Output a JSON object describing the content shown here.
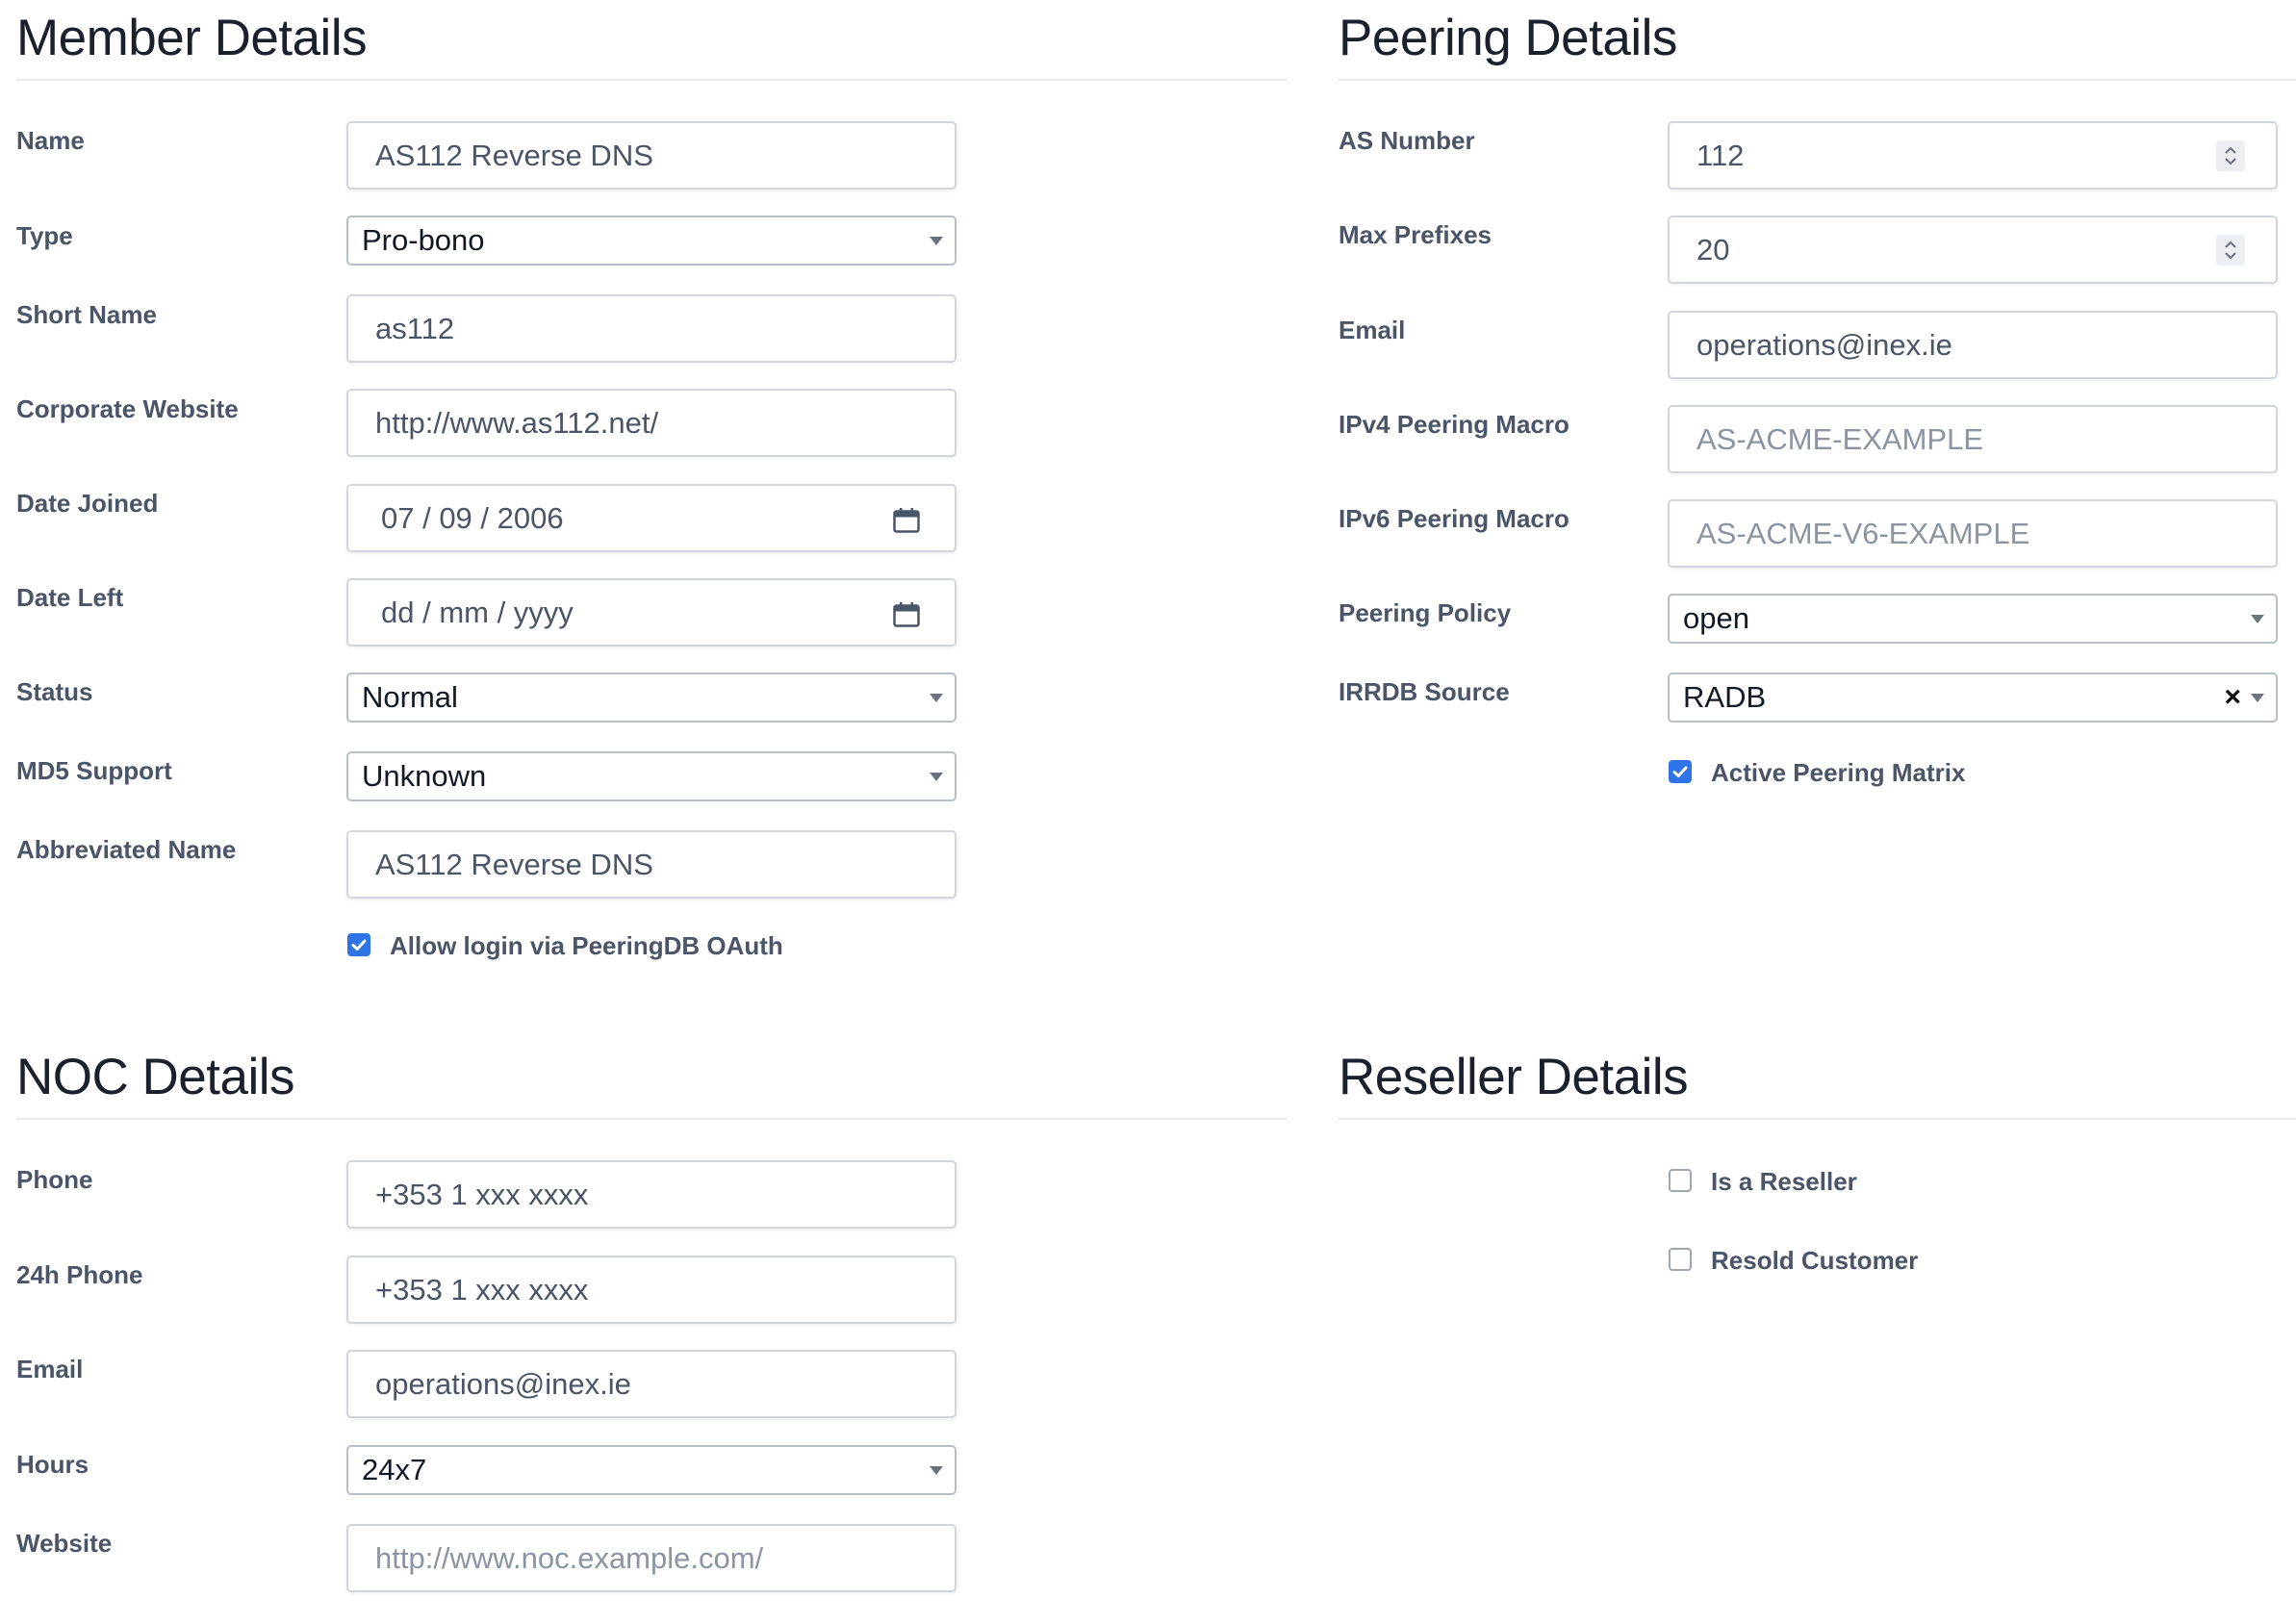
{
  "member": {
    "title": "Member Details",
    "fields": {
      "name": {
        "label": "Name",
        "value": "AS112 Reverse DNS"
      },
      "type": {
        "label": "Type",
        "value": "Pro-bono"
      },
      "short_name": {
        "label": "Short Name",
        "value": "as112"
      },
      "corporate_website": {
        "label": "Corporate Website",
        "value": "http://www.as112.net/"
      },
      "date_joined": {
        "label": "Date Joined",
        "value": "07 / 09 / 2006"
      },
      "date_left": {
        "label": "Date Left",
        "value": "dd / mm / yyyy"
      },
      "status": {
        "label": "Status",
        "value": "Normal"
      },
      "md5_support": {
        "label": "MD5 Support",
        "value": "Unknown"
      },
      "abbreviated_name": {
        "label": "Abbreviated Name",
        "value": "AS112 Reverse DNS"
      }
    },
    "peeringdb_oauth": {
      "label": "Allow login via PeeringDB OAuth",
      "checked": true
    }
  },
  "peering": {
    "title": "Peering Details",
    "fields": {
      "as_number": {
        "label": "AS Number",
        "value": "112"
      },
      "max_prefixes": {
        "label": "Max Prefixes",
        "value": "20"
      },
      "email": {
        "label": "Email",
        "value": "operations@inex.ie"
      },
      "ipv4_macro": {
        "label": "IPv4 Peering Macro",
        "placeholder": "AS-ACME-EXAMPLE"
      },
      "ipv6_macro": {
        "label": "IPv6 Peering Macro",
        "placeholder": "AS-ACME-V6-EXAMPLE"
      },
      "policy": {
        "label": "Peering Policy",
        "value": "open"
      },
      "irrdb": {
        "label": "IRRDB Source",
        "value": "RADB",
        "clear": "×"
      }
    },
    "active_matrix": {
      "label": "Active Peering Matrix",
      "checked": true
    }
  },
  "noc": {
    "title": "NOC Details",
    "fields": {
      "phone": {
        "label": "Phone",
        "value": "+353 1 xxx xxxx"
      },
      "phone_24h": {
        "label": "24h Phone",
        "value": "+353 1 xxx xxxx"
      },
      "email": {
        "label": "Email",
        "value": "operations@inex.ie"
      },
      "hours": {
        "label": "Hours",
        "value": "24x7"
      },
      "website": {
        "label": "Website",
        "placeholder": "http://www.noc.example.com/"
      }
    }
  },
  "reseller": {
    "title": "Reseller Details",
    "is_reseller": {
      "label": "Is a Reseller",
      "checked": false
    },
    "resold_customer": {
      "label": "Resold Customer",
      "checked": false
    }
  },
  "colors": {
    "accent": "#2f74e6",
    "label": "#4a5568",
    "border": "#d2d6dc"
  },
  "icons": [
    "calendar-icon",
    "spinner-icon",
    "caret-down-icon",
    "check-icon",
    "clear-icon"
  ]
}
